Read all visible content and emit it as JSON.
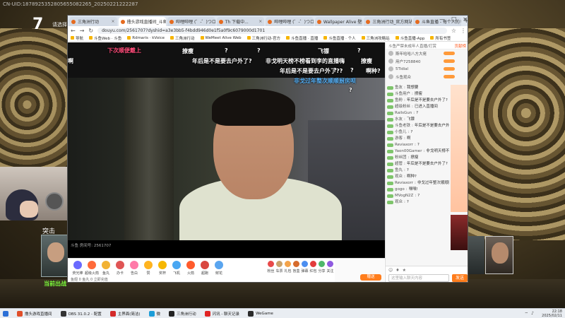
{
  "overlay": {
    "stream_id": "CN-UID:1878925352805655082265_20250221222287",
    "round_number": "7",
    "round_tag": "请选择",
    "breach_label": "突击",
    "deploy_label": "当前出战"
  },
  "browser": {
    "tabs": [
      {
        "label": "三角洲行动",
        "active": false
      },
      {
        "label": "撸头游戏直播间_斗鱼",
        "active": true
      },
      {
        "label": "哔哩哔哩 (゜-゜)つロ",
        "active": false
      },
      {
        "label": "Th 下载中...",
        "active": false
      },
      {
        "label": "哔哩哔哩 (゜-゜)つロ",
        "active": false
      },
      {
        "label": "Wallpaper Alive 壁纸",
        "active": false
      },
      {
        "label": "三角洲行动_官方网站",
        "active": false
      },
      {
        "label": "斗鱼直播 - 每个人的",
        "active": false
      }
    ],
    "new_tab": "+",
    "url": "douyu.com/2561707?dyshid=a3e3bb5-f4bdd946d0e1f5a0f9c6079000d1701",
    "bookmarks": [
      "导航",
      "斗鱼Web · 斗鱼",
      "Rdmaris · kVoice",
      "三角洲行动",
      "WeMeet Alive Web",
      "三角洲行动-官方",
      "斗鱼直播 · 直播",
      "斗鱼直播 · 个人",
      "三角洲攻略站",
      "斗鱼直播-App",
      "所有书签"
    ]
  },
  "video": {
    "danmaku": [
      {
        "text": "下次顺便戴上",
        "color": "pink"
      },
      {
        "text": "撩瘦",
        "color": "white"
      },
      {
        "text": "?",
        "color": "white"
      },
      {
        "text": "?",
        "color": "white"
      },
      {
        "text": "飞镖",
        "color": "white"
      },
      {
        "text": "?",
        "color": "white"
      },
      {
        "text": "啊",
        "color": "white"
      },
      {
        "text": "年后是不是要去户外了?",
        "color": "white"
      },
      {
        "text": "非戈明天榜不榜看到李的直播嗨",
        "color": "white"
      },
      {
        "text": "撩瘦",
        "color": "white"
      },
      {
        "text": "年后是不是要去户外了??",
        "color": "white"
      },
      {
        "text": "?",
        "color": "white"
      },
      {
        "text": "?",
        "color": "white"
      },
      {
        "text": "啊种?",
        "color": "white"
      },
      {
        "text": "非戈过年整次顺顺厨房呗",
        "color": "blue"
      },
      {
        "text": "?",
        "color": "white"
      }
    ],
    "room_id": "斗鱼 房间号: 2561707"
  },
  "gifts": [
    {
      "name": "荧光棒",
      "color": "#6a6aff"
    },
    {
      "name": "超级火箭",
      "color": "#ff6a3a"
    },
    {
      "name": "鱼丸",
      "color": "#f2b233"
    },
    {
      "name": "办卡",
      "color": "#e05555"
    },
    {
      "name": "告白",
      "color": "#ff7aa8"
    },
    {
      "name": "赞",
      "color": "#ffb41f"
    },
    {
      "name": "奖杯",
      "color": "#f6b700"
    },
    {
      "name": "飞机",
      "color": "#49a7f2"
    },
    {
      "name": "火箭",
      "color": "#ff5b2d"
    },
    {
      "name": "超跑",
      "color": "#d9473f"
    },
    {
      "name": "鲜花",
      "color": "#5aa5ef"
    },
    {
      "name": "粉丝",
      "color": "#e84a4a"
    },
    {
      "name": "车票",
      "color": "#c9a36c"
    },
    {
      "name": "礼包",
      "color": "#f3a34a"
    },
    {
      "name": "盲盒",
      "color": "#d66b2c"
    },
    {
      "name": "弹幕",
      "color": "#4b8ef0"
    },
    {
      "name": "红包",
      "color": "#e23b3b"
    },
    {
      "name": "分享",
      "color": "#4fb86b"
    },
    {
      "name": "关注",
      "color": "#8f5ae0"
    }
  ],
  "giftbar": {
    "bottom_text": "鱼翅 0  鱼丸 0  立即充值",
    "send_label": "赠送"
  },
  "chat": {
    "header_left": "斗鱼严禁未成年人直播/打赏",
    "header_right": "贡献榜",
    "rank": [
      {
        "name": "斯年哈哈八方大佬"
      },
      {
        "name": "用户7258840"
      },
      {
        "name": "5Tidial"
      },
      {
        "name": "斗鱼观众"
      }
    ],
    "messages": [
      {
        "user": "鱼友",
        "text": "我想要"
      },
      {
        "user": "斗鱼用户",
        "text": "撩瘦"
      },
      {
        "user": "鱼粉",
        "text": "年后是不是要去户外了?"
      },
      {
        "user": "超级粉丝",
        "text": "已进入直播间"
      },
      {
        "user": "RailsGun",
        "text": "?"
      },
      {
        "user": "水友",
        "text": "飞镖"
      },
      {
        "user": "斗鱼老铁",
        "text": "年后是不是要去户外了??"
      },
      {
        "user": "小鱼儿",
        "text": "?"
      },
      {
        "user": "游客",
        "text": "啊"
      },
      {
        "user": "Reviaxorr",
        "text": "?"
      },
      {
        "user": "Yaon00Gamer",
        "text": "非戈明天榜不榜看李直播嗨"
      },
      {
        "user": "粉丝团",
        "text": "撩瘦"
      },
      {
        "user": "超管",
        "text": "年后是不是要去户外了?"
      },
      {
        "user": "鱼丸",
        "text": "?"
      },
      {
        "user": "观众",
        "text": "啊种?"
      },
      {
        "user": "Reviaxorr",
        "text": "非戈过年整次顺顺厨房呗"
      },
      {
        "user": "gogo",
        "text": "嘿嘿!"
      },
      {
        "user": "MVogN2Z",
        "text": "?"
      },
      {
        "user": "观众",
        "text": "?"
      }
    ],
    "input_placeholder": "这里输入聊天内容",
    "send_label": "发送"
  },
  "taskbar": {
    "items": [
      {
        "label": "撸头游戏直播间",
        "color": "#e04f2a"
      },
      {
        "label": "OBS 31.0.2 - 配置",
        "color": "#333333"
      },
      {
        "label": "主界面(简洁)",
        "color": "#d42a2a"
      },
      {
        "label": "微",
        "color": "#1c9dd8"
      },
      {
        "label": "三角洲行动",
        "color": "#222222"
      },
      {
        "label": "闪讯 - 聊天记录",
        "color": "#e02424"
      },
      {
        "label": "WeGame",
        "color": "#2b2b2b"
      }
    ],
    "time": "22:18",
    "date": "2025/02/11"
  },
  "colors": {
    "accent": "#ff7d1c",
    "danmaku_pink": "#ff4d7a",
    "danmaku_blue": "#5cb8ff",
    "deploy_green": "#7cfc3b"
  }
}
